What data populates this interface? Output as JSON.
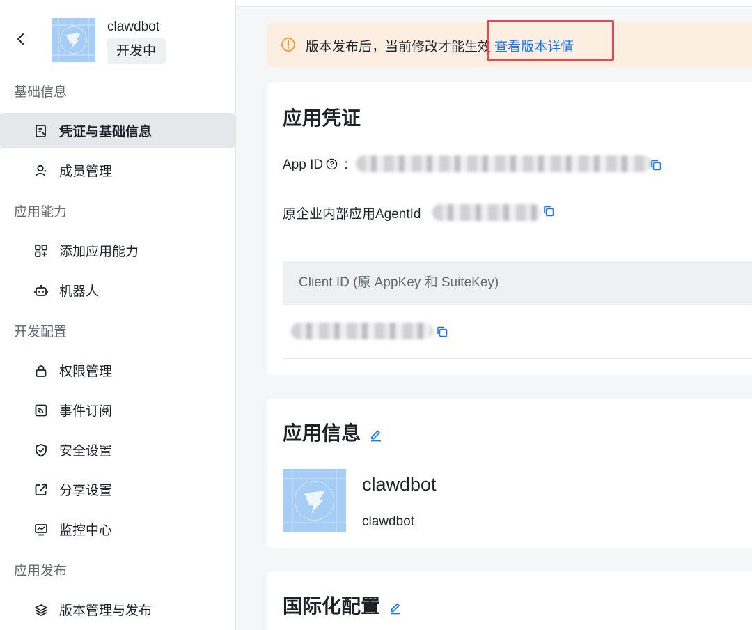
{
  "app": {
    "name": "clawdbot",
    "status": "开发中"
  },
  "sidebar": {
    "groups": [
      {
        "title": "基础信息",
        "items": [
          {
            "label": "凭证与基础信息",
            "icon": "document-icon",
            "active": true
          },
          {
            "label": "成员管理",
            "icon": "user-icon"
          }
        ]
      },
      {
        "title": "应用能力",
        "items": [
          {
            "label": "添加应用能力",
            "icon": "apps-add-icon"
          },
          {
            "label": "机器人",
            "icon": "robot-icon"
          }
        ]
      },
      {
        "title": "开发配置",
        "items": [
          {
            "label": "权限管理",
            "icon": "lock-icon"
          },
          {
            "label": "事件订阅",
            "icon": "rss-icon"
          },
          {
            "label": "安全设置",
            "icon": "shield-icon"
          },
          {
            "label": "分享设置",
            "icon": "share-icon"
          },
          {
            "label": "监控中心",
            "icon": "monitor-icon"
          }
        ]
      },
      {
        "title": "应用发布",
        "items": [
          {
            "label": "版本管理与发布",
            "icon": "layers-icon"
          }
        ]
      }
    ]
  },
  "notice": {
    "text": "版本发布后，当前修改才能生效",
    "link": "查看版本详情"
  },
  "credentials": {
    "title": "应用凭证",
    "app_id_label": "App ID",
    "app_id_sep": " :",
    "agent_id_label": "原企业内部应用AgentId",
    "client_id_header": "Client ID (原 AppKey 和 SuiteKey)"
  },
  "app_info": {
    "title": "应用信息",
    "name": "clawdbot",
    "description": "clawdbot"
  },
  "intl": {
    "title": "国际化配置"
  },
  "colors": {
    "accent": "#1677ff",
    "notice_bg": "#fcefe2",
    "notice_icon": "#f59a23",
    "highlight": "#e8474d",
    "logo_bg": "#a6cdf6"
  }
}
